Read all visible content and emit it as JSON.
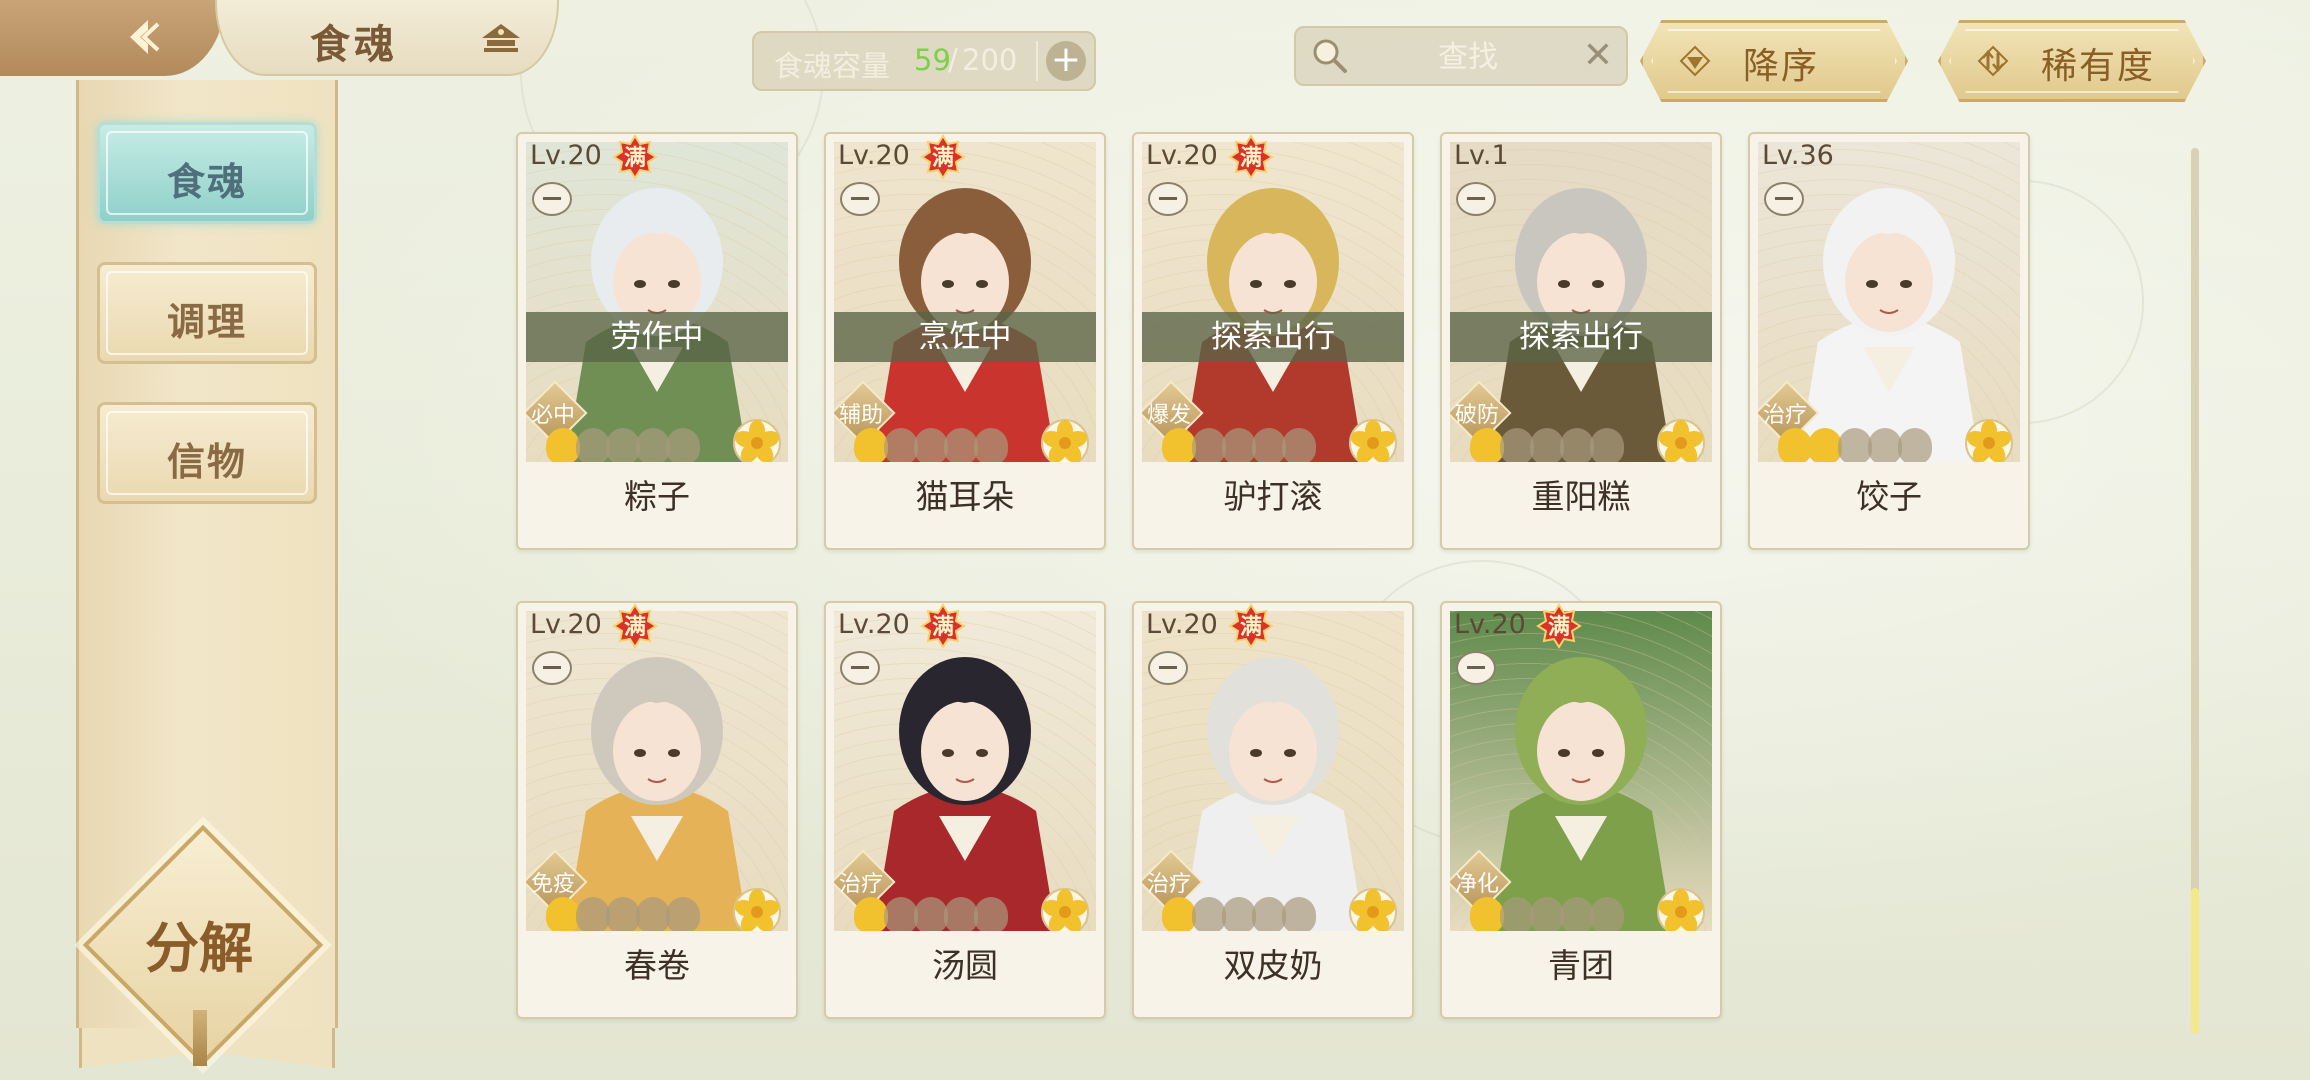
{
  "header": {
    "title": "食魂",
    "capacity": {
      "label": "食魂容量",
      "current": "59",
      "separator": "/",
      "max": "200",
      "add": "+"
    },
    "search": {
      "placeholder": "查找",
      "clear": "✕"
    },
    "sort_order": {
      "label": "降序",
      "icon": "triangle-down"
    },
    "sort_key": {
      "label": "稀有度",
      "icon": "swap"
    }
  },
  "sidebar": {
    "tabs": [
      {
        "label": "食魂",
        "active": true
      },
      {
        "label": "调理",
        "active": false
      },
      {
        "label": "信物",
        "active": false
      }
    ],
    "decompose": "分解"
  },
  "cards": [
    {
      "name": "粽子",
      "level": "Lv.20",
      "full": "满",
      "status": "劳作中",
      "role": "必中",
      "stars": 1,
      "hair": "#e9ecef",
      "cloth": "#6f8f55",
      "bg": "#dfe6d8"
    },
    {
      "name": "猫耳朵",
      "level": "Lv.20",
      "full": "满",
      "status": "烹饪中",
      "role": "辅助",
      "stars": 1,
      "hair": "#8a5e3b",
      "cloth": "#c9352e",
      "bg": "#efe4cd"
    },
    {
      "name": "驴打滚",
      "level": "Lv.20",
      "full": "满",
      "status": "探索出行",
      "role": "爆发",
      "stars": 1,
      "hair": "#d8b65c",
      "cloth": "#b23a2d",
      "bg": "#f0e6cf"
    },
    {
      "name": "重阳糕",
      "level": "Lv.1",
      "full": "",
      "status": "探索出行",
      "role": "破防",
      "stars": 1,
      "hair": "#c9c6bf",
      "cloth": "#6a5a3a",
      "bg": "#e6dcc6"
    },
    {
      "name": "饺子",
      "level": "Lv.36",
      "full": "",
      "status": "",
      "role": "治疗",
      "stars": 2,
      "hair": "#f2f2f2",
      "cloth": "#f4f4f4",
      "bg": "#ece6d9"
    },
    {
      "name": "春卷",
      "level": "Lv.20",
      "full": "满",
      "status": "",
      "role": "免疫",
      "stars": 1,
      "hair": "#cfc8bd",
      "cloth": "#e6b257",
      "bg": "#efe6d2"
    },
    {
      "name": "汤圆",
      "level": "Lv.20",
      "full": "满",
      "status": "",
      "role": "治疗",
      "stars": 1,
      "hair": "#2a2630",
      "cloth": "#a8282c",
      "bg": "#f1ead9"
    },
    {
      "name": "双皮奶",
      "level": "Lv.20",
      "full": "满",
      "status": "",
      "role": "治疗",
      "stars": 1,
      "hair": "#e2e0db",
      "cloth": "#efefef",
      "bg": "#eee3c8"
    },
    {
      "name": "青团",
      "level": "Lv.20",
      "full": "满",
      "status": "",
      "role": "净化",
      "stars": 1,
      "hair": "#8fae55",
      "cloth": "#7ea04a",
      "bg": "#5f8a4c"
    }
  ],
  "colors": {
    "accent_gold": "#c9a867",
    "active_tab": "#8fd0c9",
    "capacity_green": "#7fcf4b",
    "badge_red": "#d8322a",
    "star_gold": "#f2c12e",
    "star_dim": "#a89a7c"
  }
}
